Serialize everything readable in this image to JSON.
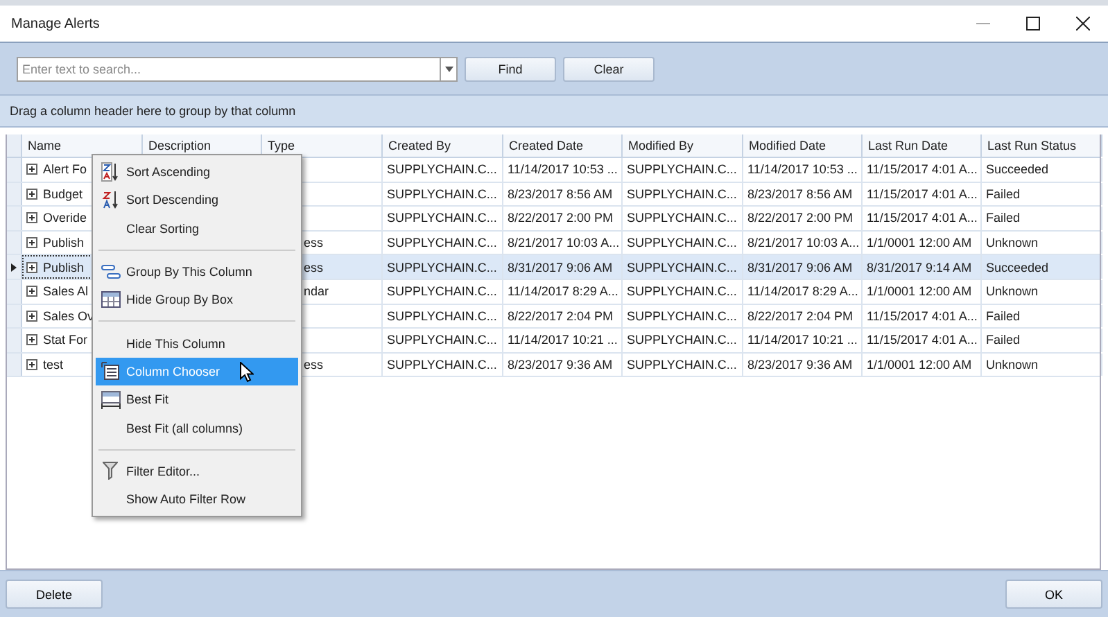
{
  "window": {
    "title": "Manage Alerts"
  },
  "search": {
    "placeholder": "Enter text to search..."
  },
  "search_buttons": [
    "Find",
    "Clear"
  ],
  "group_panel": "Drag a column header here to group by that column",
  "table": {
    "columns": [
      "Name",
      "Description",
      "Type",
      "Created By",
      "Created Date",
      "Modified By",
      "Modified Date",
      "Last Run Date",
      "Last Run Status"
    ],
    "rows": [
      {
        "selected": false,
        "cells": [
          "Alert Fo",
          "",
          "",
          "SUPPLYCHAIN.C...",
          "11/14/2017 10:53 ...",
          "SUPPLYCHAIN.C...",
          "11/14/2017 10:53 ...",
          "11/15/2017 4:01 A...",
          "Succeeded"
        ]
      },
      {
        "selected": false,
        "cells": [
          "Budget",
          "",
          "",
          "SUPPLYCHAIN.C...",
          "8/23/2017 8:56 AM",
          "SUPPLYCHAIN.C...",
          "8/23/2017 8:56 AM",
          "11/15/2017 4:01 A...",
          "Failed"
        ]
      },
      {
        "selected": false,
        "cells": [
          "Overide",
          "",
          "",
          "SUPPLYCHAIN.C...",
          "8/22/2017 2:00 PM",
          "SUPPLYCHAIN.C...",
          "8/22/2017 2:00 PM",
          "11/15/2017 4:01 A...",
          "Failed"
        ]
      },
      {
        "selected": false,
        "cells": [
          "Publish",
          "",
          "ess",
          "SUPPLYCHAIN.C...",
          "8/21/2017 10:03 A...",
          "SUPPLYCHAIN.C...",
          "8/21/2017 10:03 A...",
          "1/1/0001 12:00 AM",
          "Unknown"
        ]
      },
      {
        "selected": true,
        "cells": [
          "Publish",
          "",
          "ess",
          "SUPPLYCHAIN.C...",
          "8/31/2017 9:06 AM",
          "SUPPLYCHAIN.C...",
          "8/31/2017 9:06 AM",
          "8/31/2017 9:14 AM",
          "Succeeded"
        ]
      },
      {
        "selected": false,
        "cells": [
          "Sales Al",
          "",
          "ndar",
          "SUPPLYCHAIN.C...",
          "11/14/2017 8:29 A...",
          "SUPPLYCHAIN.C...",
          "11/14/2017 8:29 A...",
          "1/1/0001 12:00 AM",
          "Unknown"
        ]
      },
      {
        "selected": false,
        "cells": [
          "Sales Ov",
          "",
          "",
          "SUPPLYCHAIN.C...",
          "8/22/2017 2:04 PM",
          "SUPPLYCHAIN.C...",
          "8/22/2017 2:04 PM",
          "11/15/2017 4:01 A...",
          "Failed"
        ]
      },
      {
        "selected": false,
        "cells": [
          "Stat For",
          "",
          "",
          "SUPPLYCHAIN.C...",
          "11/14/2017 10:21 ...",
          "SUPPLYCHAIN.C...",
          "11/14/2017 10:21 ...",
          "11/15/2017 4:01 A...",
          "Failed"
        ]
      },
      {
        "selected": false,
        "cells": [
          "test",
          "",
          "ess",
          "SUPPLYCHAIN.C...",
          "8/23/2017 9:36 AM",
          "SUPPLYCHAIN.C...",
          "8/23/2017 9:36 AM",
          "1/1/0001 12:00 AM",
          "Unknown"
        ]
      }
    ]
  },
  "context_menu": {
    "groups": [
      [
        {
          "label": "Sort Ascending",
          "selected": false
        },
        {
          "label": "Sort Descending",
          "selected": false
        },
        {
          "label": "Clear Sorting",
          "selected": false
        }
      ],
      [
        {
          "label": "Group By This Column",
          "selected": false
        },
        {
          "label": "Hide Group By Box",
          "selected": false
        }
      ],
      [
        {
          "label": "Hide This Column",
          "selected": false
        },
        {
          "label": "Column Chooser",
          "selected": true
        },
        {
          "label": "Best Fit",
          "selected": false
        },
        {
          "label": "Best Fit (all columns)",
          "selected": false
        }
      ],
      [
        {
          "label": "Filter Editor...",
          "selected": false
        },
        {
          "label": "Show Auto Filter Row",
          "selected": false
        }
      ]
    ]
  },
  "footer_buttons": [
    "Delete",
    "OK"
  ]
}
